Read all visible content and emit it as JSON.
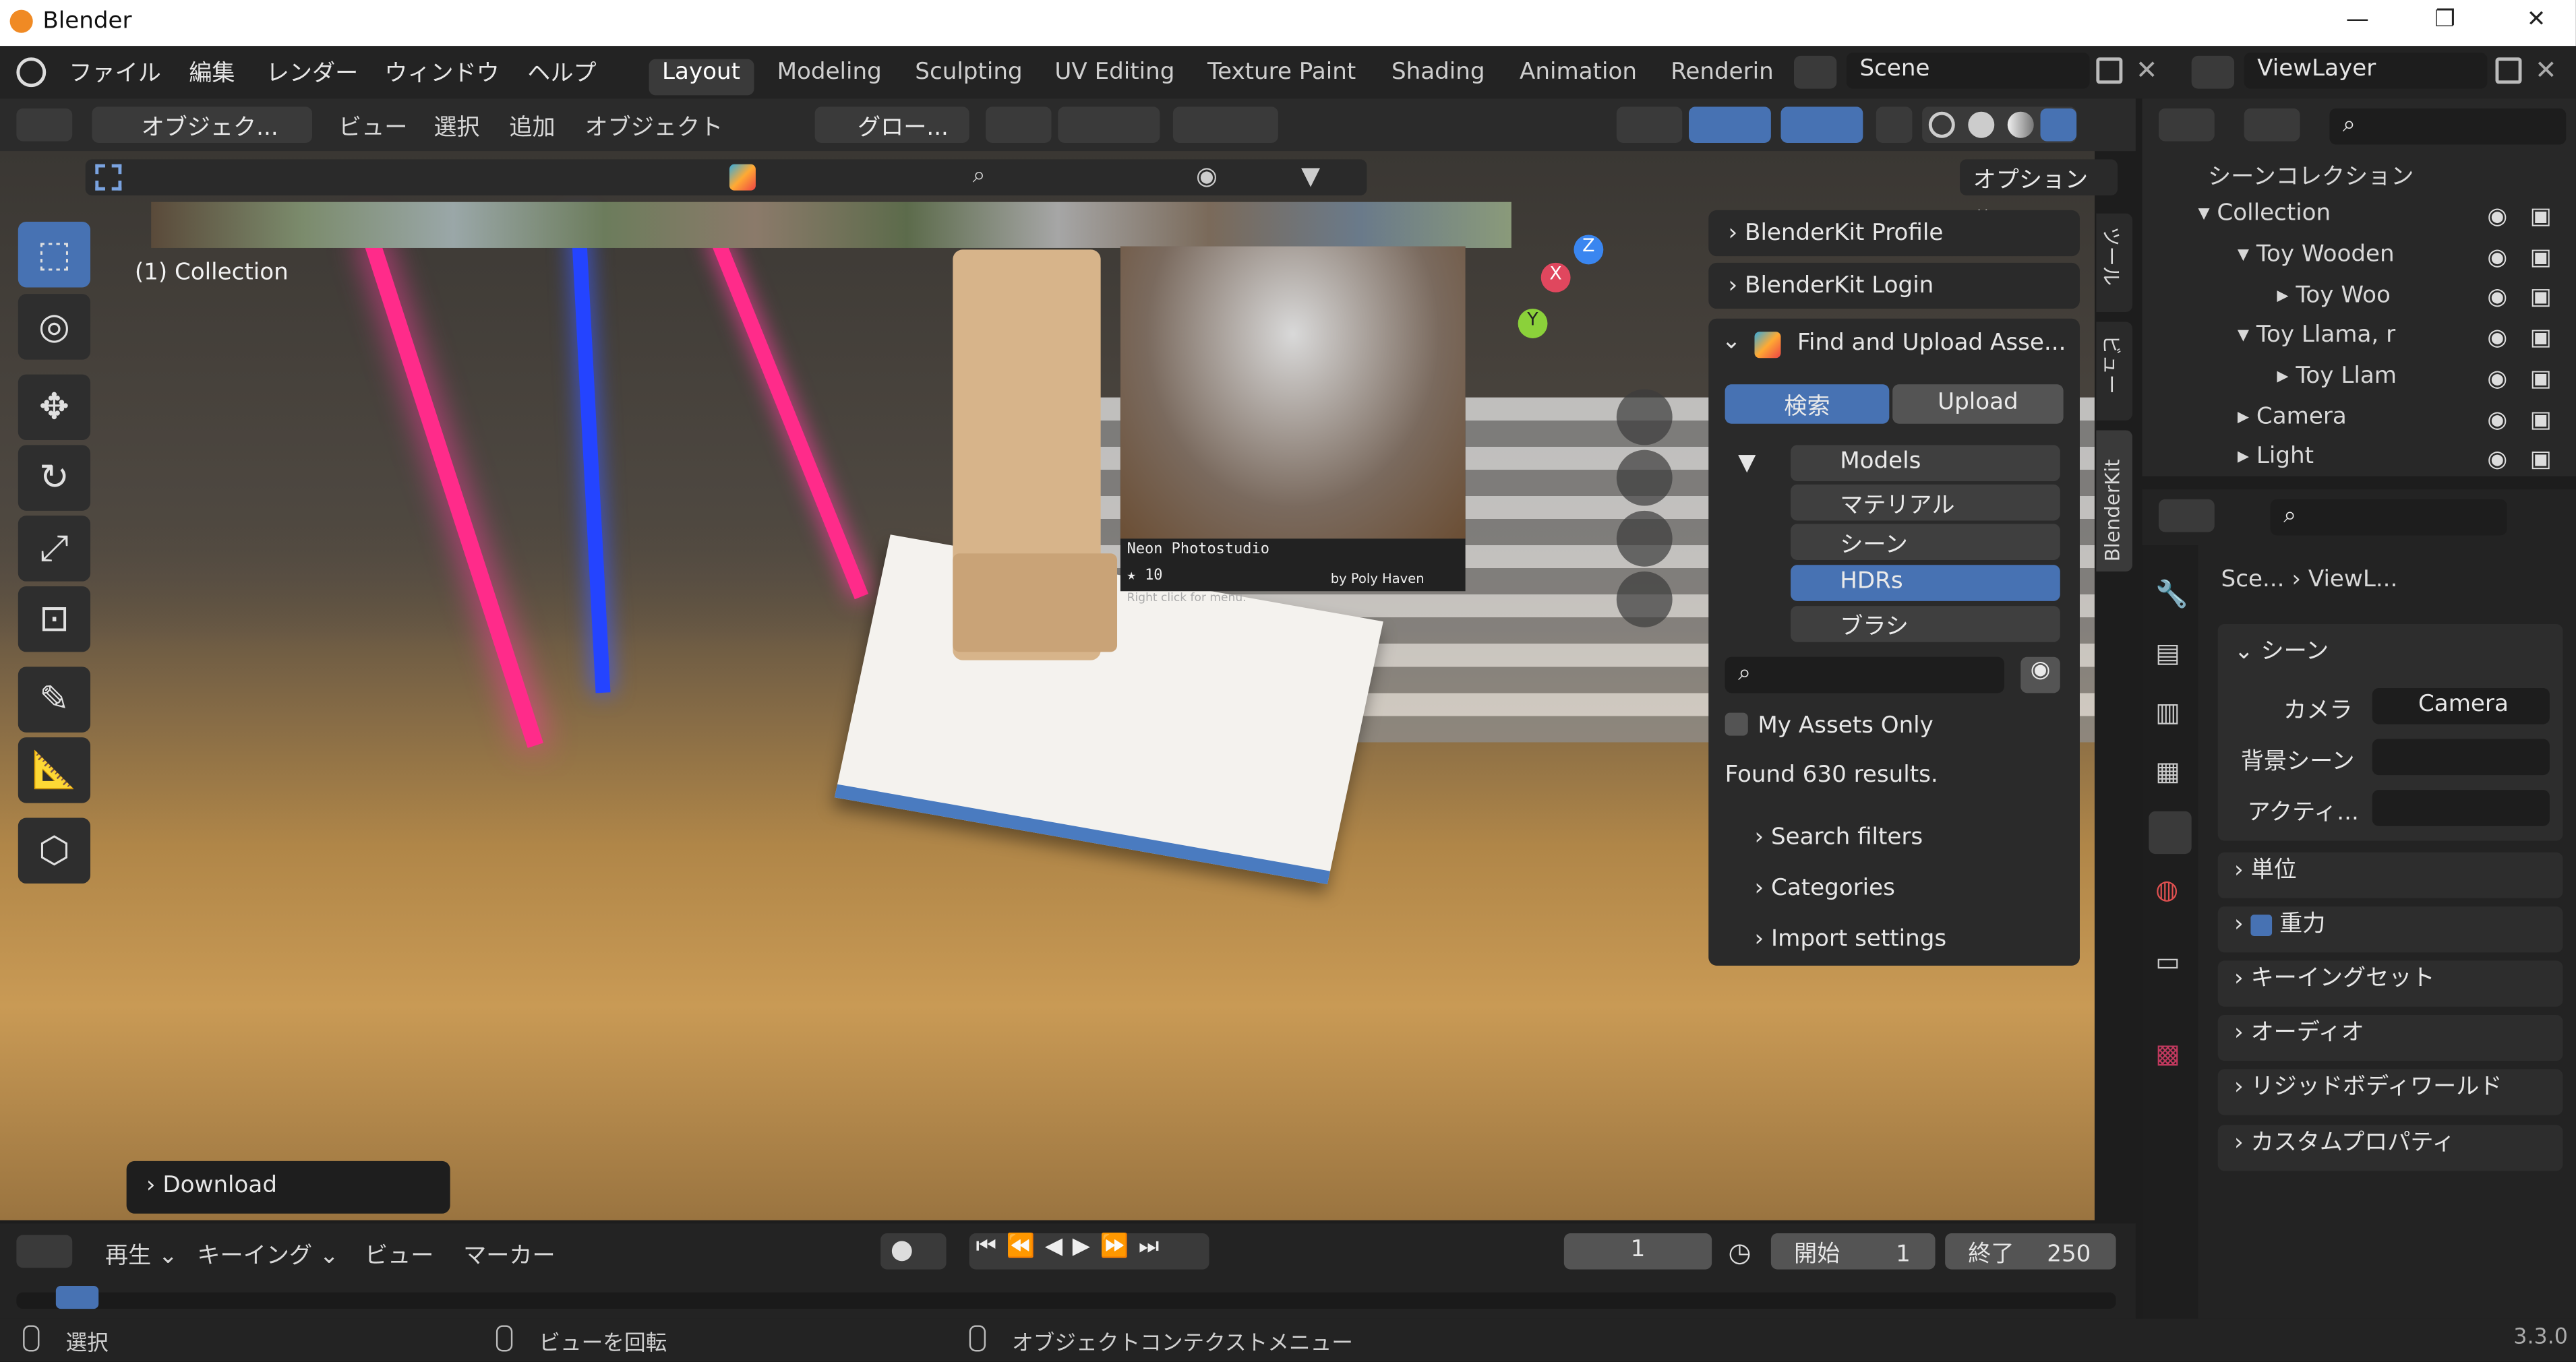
{
  "window": {
    "title": "Blender",
    "version": "3.3.0",
    "buttons": {
      "minimize": "—",
      "restore": "❐",
      "close": "✕"
    }
  },
  "menu": [
    "ファイル",
    "編集",
    "レンダー",
    "ウィンドウ",
    "ヘルプ"
  ],
  "workspaces": [
    "Layout",
    "Modeling",
    "Sculpting",
    "UV Editing",
    "Texture Paint",
    "Shading",
    "Animation",
    "Renderin"
  ],
  "scene": {
    "name": "Scene",
    "viewlayer": "ViewLayer"
  },
  "viewport_header": {
    "mode": "オブジェク...",
    "menus": [
      "ビュー",
      "選択",
      "追加",
      "オブジェクト"
    ],
    "transform": "グロー...",
    "options": "オプション"
  },
  "viewport": {
    "collection_label": "(1) Collection",
    "download_label": "Download"
  },
  "asset_preview": {
    "name": "Neon Photostudio",
    "rating": "10",
    "author": "by Poly Haven",
    "hint": "Right click for menu."
  },
  "blenderkit": {
    "profile": "BlenderKit Profile",
    "login": "BlenderKit Login",
    "find": "Find and Upload Asse...",
    "search_tab": "検索",
    "upload_tab": "Upload",
    "categories": [
      "Models",
      "マテリアル",
      "シーン",
      "HDRs",
      "ブラシ"
    ],
    "selected_category": "HDRs",
    "my_assets": "My Assets Only",
    "found": "Found 630 results.",
    "sections": [
      "Search filters",
      "Categories",
      "Import settings"
    ]
  },
  "sidebar_tabs": [
    "ツール",
    "ビュー",
    "BlenderKit"
  ],
  "outliner": {
    "title": "シーンコレクション",
    "items": [
      {
        "label": "Collection",
        "depth": 0
      },
      {
        "label": "Toy Wooden",
        "depth": 1
      },
      {
        "label": "Toy Woo",
        "depth": 2
      },
      {
        "label": "Toy Llama, r",
        "depth": 1
      },
      {
        "label": "Toy Llam",
        "depth": 2
      },
      {
        "label": "Camera",
        "depth": 1
      },
      {
        "label": "Light",
        "depth": 1
      }
    ]
  },
  "properties": {
    "breadcrumb": [
      "Sce...",
      "ViewL..."
    ],
    "scene_section": "シーン",
    "camera_label": "カメラ",
    "camera_value": "Camera",
    "bg_scene_label": "背景シーン",
    "active_label": "アクティ...",
    "sections": [
      "単位",
      "重力",
      "キーイングセット",
      "オーディオ",
      "リジッドボディワールド",
      "カスタムプロパティ"
    ]
  },
  "timeline": {
    "play": "再生",
    "keying": "キーイング",
    "view": "ビュー",
    "marker": "マーカー",
    "frame": "1",
    "start_label": "開始",
    "start": "1",
    "end_label": "終了",
    "end": "250"
  },
  "status": {
    "select": "選択",
    "rotate": "ビューを回転",
    "context": "オブジェクトコンテクストメニュー"
  },
  "colors": {
    "accent": "#4772b3",
    "bg": "#1d1d1d",
    "panel": "#2a2a2a"
  }
}
